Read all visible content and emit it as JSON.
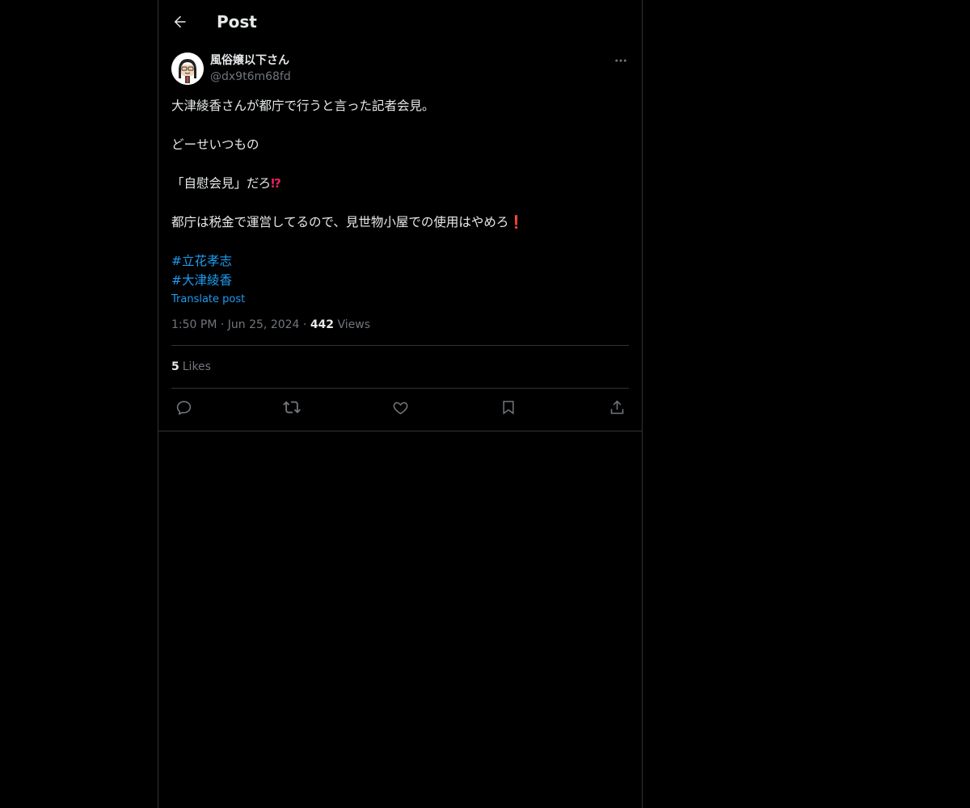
{
  "topbar": {
    "title": "Post"
  },
  "post": {
    "display_name": "風俗嬢以下さん",
    "handle": "@dx9t6m68fd",
    "lines": [
      "大津綾香さんが都庁で行うと言った記者会見。",
      "どーせいつもの",
      "「自慰会見」だろ",
      "都庁は税金で運営してるので、見世物小屋での使用はやめろ"
    ],
    "emoji_1": "⁉",
    "emoji_2": "❗",
    "hashtags": [
      "#立花孝志",
      "#大津綾香"
    ],
    "translate_label": "Translate post",
    "time": "1:50 PM",
    "date": "Jun 25, 2024",
    "views_count": "442",
    "views_label": "Views",
    "likes_count": "5",
    "likes_label": "Likes"
  },
  "colors": {
    "accent": "#1d9bf0",
    "background": "#000000",
    "border": "#2f3336",
    "muted": "#71767b",
    "text": "#e7e9ea"
  },
  "icons": [
    "back-arrow-icon",
    "more-icon",
    "reply-icon",
    "repost-icon",
    "like-icon",
    "bookmark-icon",
    "share-icon"
  ]
}
